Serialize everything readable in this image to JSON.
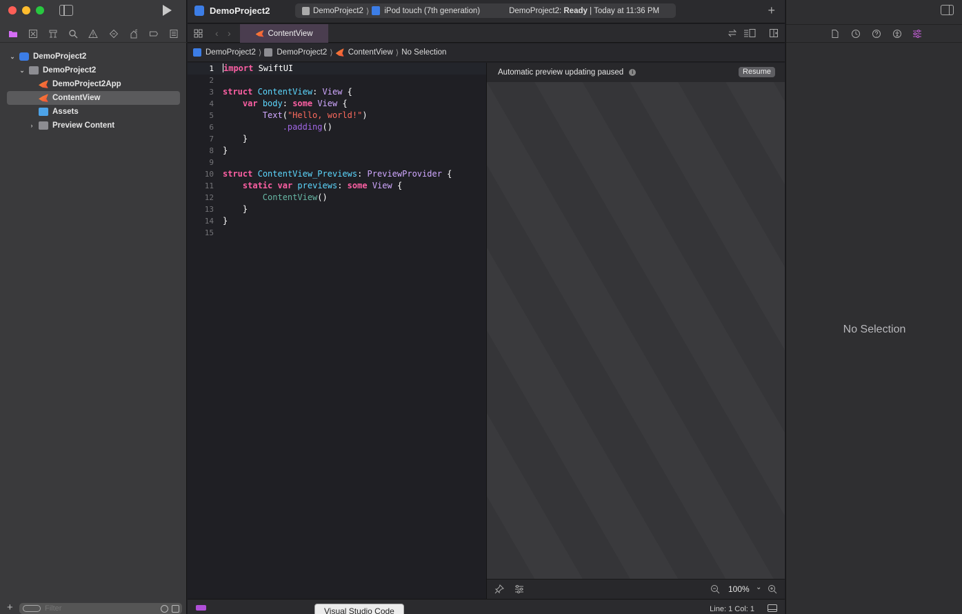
{
  "navigator": {
    "tree": [
      {
        "label": "DemoProject2",
        "level": 0,
        "expanded": true,
        "icon": "project-icon"
      },
      {
        "label": "DemoProject2",
        "level": 1,
        "expanded": true,
        "icon": "folder-icon"
      },
      {
        "label": "DemoProject2App",
        "level": 2,
        "icon": "swift-file-icon"
      },
      {
        "label": "ContentView",
        "level": 2,
        "icon": "swift-file-icon",
        "selected": true
      },
      {
        "label": "Assets",
        "level": 2,
        "icon": "assets-icon"
      },
      {
        "label": "Preview Content",
        "level": 2,
        "expanded": false,
        "icon": "folder-icon"
      }
    ],
    "filter_placeholder": "Filter"
  },
  "topbar": {
    "project_title": "DemoProject2",
    "scheme": "DemoProject2",
    "device": "iPod touch (7th generation)",
    "status_prefix": "DemoProject2: ",
    "status_bold": "Ready",
    "status_suffix": " | Today at 11:36 PM"
  },
  "tabbar": {
    "active_tab": "ContentView"
  },
  "breadcrumb": {
    "items": [
      "DemoProject2",
      "DemoProject2",
      "ContentView",
      "No Selection"
    ]
  },
  "editor": {
    "lines": [
      {
        "n": "1"
      },
      {
        "n": "2"
      },
      {
        "n": "3"
      },
      {
        "n": "4"
      },
      {
        "n": "5"
      },
      {
        "n": "6"
      },
      {
        "n": "7"
      },
      {
        "n": "8"
      },
      {
        "n": "9"
      },
      {
        "n": "10"
      },
      {
        "n": "11"
      },
      {
        "n": "12"
      },
      {
        "n": "13"
      },
      {
        "n": "14"
      },
      {
        "n": "15"
      }
    ],
    "tokens": {
      "import": "import",
      "swiftui": " SwiftUI",
      "struct": "struct",
      "contentview": "ContentView",
      "colon": ": ",
      "view": "View",
      "brace_open": " {",
      "var": "var",
      "body": "body",
      "some": "some",
      "text": "Text",
      "paren_open": "(",
      "hello": "\"Hello, world!\"",
      "paren_close": ")",
      "padding": ".padding",
      "parens": "()",
      "brace_close": "}",
      "previews_struct": "ContentView_Previews",
      "previewprovider": "PreviewProvider",
      "static": "static",
      "previews": "previews",
      "contentview_call": "ContentView"
    }
  },
  "preview": {
    "message": "Automatic preview updating paused",
    "info": "i",
    "resume": "Resume",
    "zoom": "100%"
  },
  "statusbar": {
    "tooltip": "Visual Studio Code",
    "line_col": "Line: 1  Col: 1"
  },
  "inspector": {
    "no_selection": "No Selection"
  },
  "colors": {
    "accent": "#3c7de6",
    "keyword": "#fc5fa3",
    "type": "#5dd8ff",
    "string": "#fc6a5d",
    "swift": "#f05138",
    "traffic_red": "#fe5f57",
    "traffic_yellow": "#febc2e",
    "traffic_green": "#28c840"
  }
}
